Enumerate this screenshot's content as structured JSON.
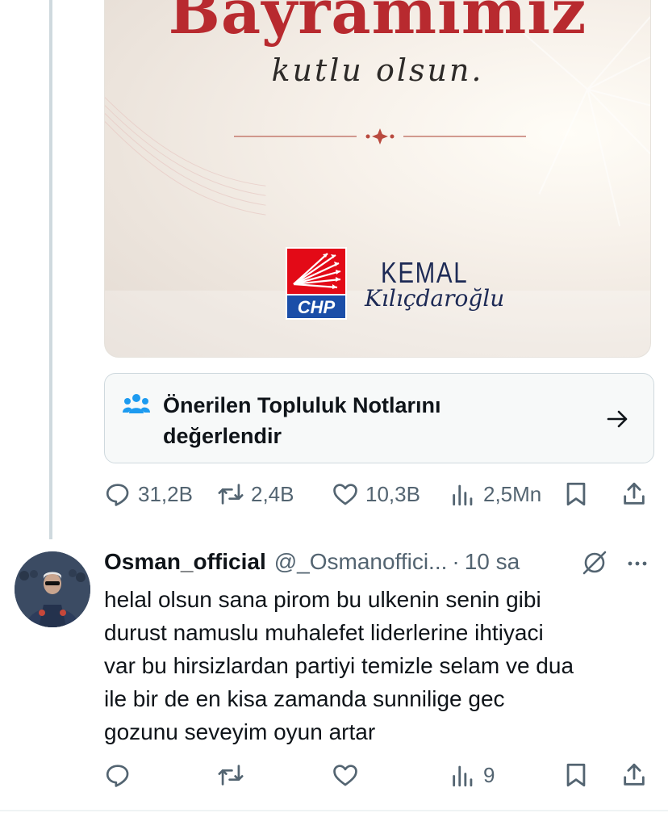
{
  "media": {
    "headline": "Bayramımız",
    "script_text": "kutlu olsun.",
    "party_logo_text": "CHP",
    "signature_name": "KEMAL",
    "signature_surname": "Kılıçdaroğlu"
  },
  "community_notes": {
    "label": "Önerilen Topluluk Notlarını değerlendir",
    "icon": "people-icon",
    "arrow_icon": "arrow-right-icon"
  },
  "main_tweet_actions": {
    "replies": "31,2B",
    "retweets": "2,4B",
    "likes": "10,3B",
    "views": "2,5Mn"
  },
  "reply": {
    "display_name": "Osman_official",
    "handle": "@_Osmanoffici...",
    "separator": "·",
    "time": "10 sa",
    "text": "helal olsun sana pirom bu ulkenin senin gibi\ndurust namuslu muhalefet liderlerine ihtiyaci\nvar bu hirsizlardan partiyi temizle selam ve dua\nile bir de en kisa zamanda sunnilige gec\ngozunu seveyim oyun artar",
    "actions": {
      "views": "9"
    }
  },
  "colors": {
    "accent": "#1d9bf0",
    "text_primary": "#0f1419",
    "text_secondary": "#536471",
    "headline_red": "#b82a2f",
    "chp_red": "#e30a17",
    "chp_blue": "#1b4ea8"
  }
}
